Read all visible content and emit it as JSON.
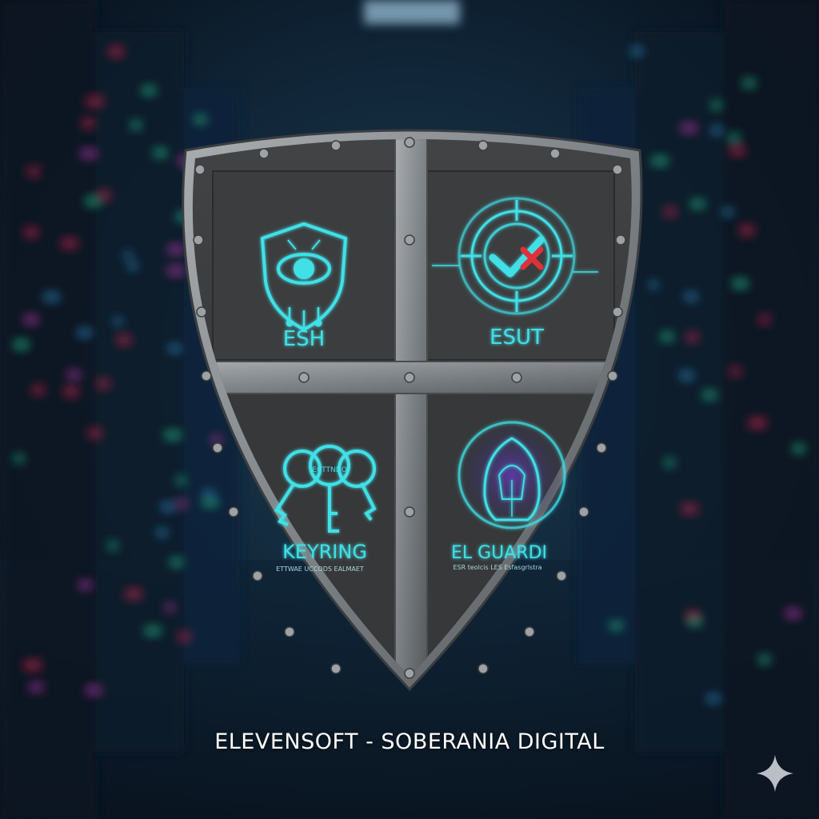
{
  "caption": "ELEVENSOFT - SOBERANIA DIGITAL",
  "quadrants": {
    "top_left": {
      "icon": "shield-eye-icon",
      "label": "ESH"
    },
    "top_right": {
      "icon": "target-check-icon",
      "label": "ESUT"
    },
    "bottom_left": {
      "icon": "keys-icon",
      "label": "KEYRING",
      "sublabel": "ETTWAE UCCODS EALMAET",
      "key_tag": "ECTTNDO"
    },
    "bottom_right": {
      "icon": "hooded-figure-icon",
      "label": "EL GUARDI",
      "sublabel": "ESR teolcis LES Esfasgrlstra"
    }
  },
  "colors": {
    "accent": "#3fe0e6",
    "metal": "#8a8e91",
    "panel": "#3a3b3d",
    "background": "#0b1a2a",
    "alert": "#e0303a"
  },
  "corner_icon": "sparkle-icon"
}
